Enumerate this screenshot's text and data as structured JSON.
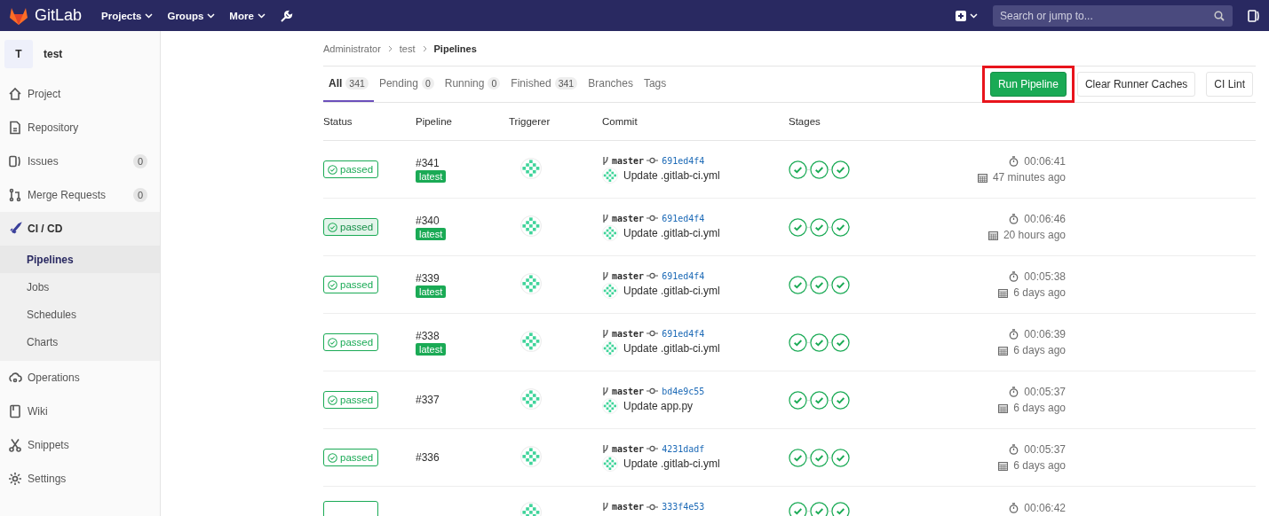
{
  "navbar": {
    "brand": "GitLab",
    "menus": [
      {
        "label": "Projects"
      },
      {
        "label": "Groups"
      },
      {
        "label": "More"
      }
    ],
    "search": {
      "placeholder": "Search or jump to..."
    }
  },
  "sidebar": {
    "project": {
      "initial": "T",
      "name": "test"
    },
    "items": [
      {
        "label": "Project",
        "kind": "home",
        "selected": false
      },
      {
        "label": "Repository",
        "kind": "doc",
        "selected": false
      },
      {
        "label": "Issues",
        "kind": "issues",
        "count": "0",
        "selected": false
      },
      {
        "label": "Merge Requests",
        "kind": "merge",
        "count": "0",
        "selected": false
      },
      {
        "label": "CI / CD",
        "kind": "rocket",
        "selected": true,
        "expanded": true,
        "children": [
          {
            "label": "Pipelines",
            "selected": true
          },
          {
            "label": "Jobs",
            "selected": false
          },
          {
            "label": "Schedules",
            "selected": false
          },
          {
            "label": "Charts",
            "selected": false
          }
        ]
      },
      {
        "label": "Operations",
        "kind": "cloud",
        "selected": false
      },
      {
        "label": "Wiki",
        "kind": "book",
        "selected": false
      },
      {
        "label": "Snippets",
        "kind": "scissors",
        "selected": false
      },
      {
        "label": "Settings",
        "kind": "gear",
        "selected": false
      }
    ]
  },
  "breadcrumb": [
    "Administrator",
    "test",
    "Pipelines"
  ],
  "tabs": [
    {
      "label": "All",
      "count": "341",
      "selected": true
    },
    {
      "label": "Pending",
      "count": "0",
      "selected": false
    },
    {
      "label": "Running",
      "count": "0",
      "selected": false
    },
    {
      "label": "Finished",
      "count": "341",
      "selected": false
    },
    {
      "label": "Branches",
      "selected": false
    },
    {
      "label": "Tags",
      "selected": false
    }
  ],
  "actions": [
    {
      "label": "Run Pipeline",
      "kind": "primary",
      "highlighted": true
    },
    {
      "label": "Clear Runner Caches",
      "kind": "default",
      "highlighted": false
    },
    {
      "label": "CI Lint",
      "kind": "default",
      "highlighted": false
    }
  ],
  "table": {
    "columns": [
      "Status",
      "Pipeline",
      "Triggerer",
      "Commit",
      "Stages"
    ],
    "rows": [
      {
        "status": "passed",
        "hovered": false,
        "id": "#341",
        "latest": "latest",
        "branch": "master",
        "sha": "691ed4f4",
        "message": "Update .gitlab-ci.yml",
        "duration": "00:06:41",
        "finished": "47 minutes ago"
      },
      {
        "status": "passed",
        "hovered": true,
        "id": "#340",
        "latest": "latest",
        "branch": "master",
        "sha": "691ed4f4",
        "message": "Update .gitlab-ci.yml",
        "duration": "00:06:46",
        "finished": "20 hours ago"
      },
      {
        "status": "passed",
        "hovered": false,
        "id": "#339",
        "latest": "latest",
        "branch": "master",
        "sha": "691ed4f4",
        "message": "Update .gitlab-ci.yml",
        "duration": "00:05:38",
        "finished": "6 days ago"
      },
      {
        "status": "passed",
        "hovered": false,
        "id": "#338",
        "latest": "latest",
        "branch": "master",
        "sha": "691ed4f4",
        "message": "Update .gitlab-ci.yml",
        "duration": "00:06:39",
        "finished": "6 days ago"
      },
      {
        "status": "passed",
        "hovered": false,
        "id": "#337",
        "branch": "master",
        "sha": "bd4e9c55",
        "message": "Update app.py",
        "duration": "00:05:37",
        "finished": "6 days ago"
      },
      {
        "status": "passed",
        "hovered": false,
        "id": "#336",
        "branch": "master",
        "sha": "4231dadf",
        "message": "Update .gitlab-ci.yml",
        "duration": "00:05:37",
        "finished": "6 days ago"
      },
      {
        "hovered": false,
        "branch": "master",
        "sha": "333f4e53",
        "duration": "00:06:42"
      }
    ]
  }
}
